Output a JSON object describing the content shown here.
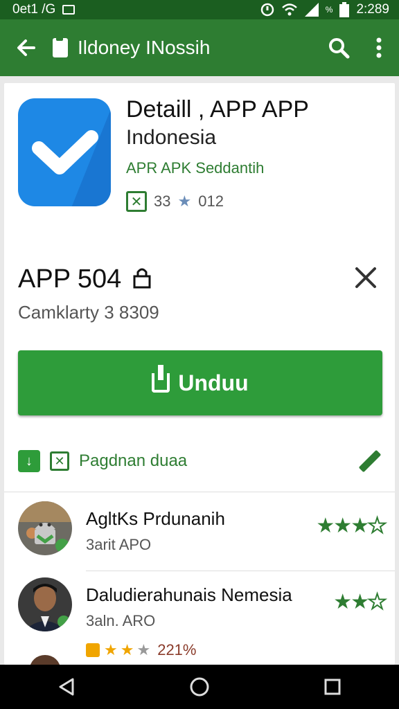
{
  "status_bar": {
    "carrier": "0et1 /G",
    "battery_pct": "%",
    "time": "2:289"
  },
  "toolbar": {
    "title": "Ildoney INossih"
  },
  "app": {
    "title": "Detaill , APP APP",
    "subtitle": "Indonesia",
    "developer": "APR APK Seddantih",
    "rating_value": "33",
    "rating_count": "012",
    "icon_colors": {
      "bg": "#1e88e5",
      "shade": "#1976d2",
      "check": "#ffffff"
    }
  },
  "section": {
    "title": "APP 504",
    "size_text": "Camklarty 3 8309"
  },
  "install": {
    "label": "Unduu"
  },
  "links": {
    "label": "Pagdnan duaa"
  },
  "reviews": [
    {
      "name": "AgltKs Prdunanih",
      "sub": "3arit  APO",
      "stars_filled": 3,
      "stars_total": 4
    },
    {
      "name": "Daludierahunais Nemesia",
      "sub": "3aln. ARO",
      "stars_filled": 2,
      "stars_total": 3
    }
  ],
  "third_review": {
    "rating_text": "221%"
  },
  "colors": {
    "accent": "#2e7d32",
    "button": "#2e9c3a",
    "status_bar": "#1b5e20"
  }
}
